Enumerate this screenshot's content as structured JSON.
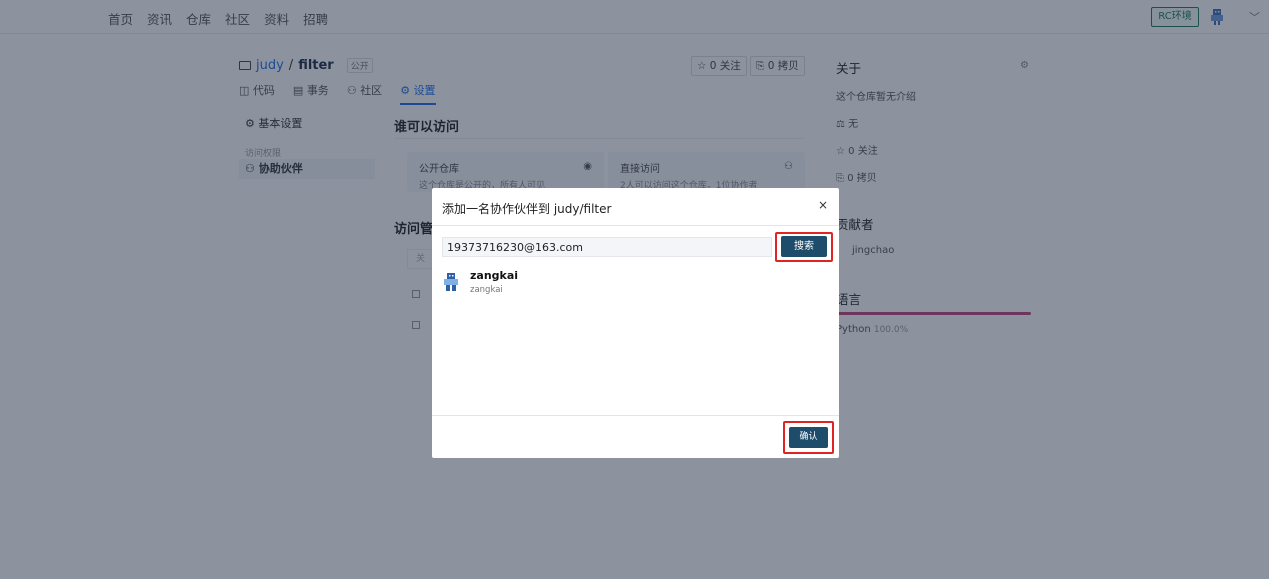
{
  "nav": {
    "items": [
      "首页",
      "资讯",
      "仓库",
      "社区",
      "资料",
      "招聘"
    ],
    "env_button": "RC环境"
  },
  "repo": {
    "owner": "judy",
    "separator": "/",
    "name": "filter",
    "visibility": "公开",
    "watch_label": "0 关注",
    "fork_label": "0 拷贝"
  },
  "tabs": [
    "代码",
    "事务",
    "社区",
    "设置"
  ],
  "settings_sidebar": {
    "basic": "基本设置",
    "group_label": "访问权限",
    "collaborators": "协助伙伴"
  },
  "access": {
    "title": "谁可以访问",
    "public_title": "公开仓库",
    "public_desc": "这个仓库是公开的，所有人可见",
    "direct_title": "直接访问",
    "direct_desc": "2人可以访问这个仓库，1位协作者",
    "manage_title": "访问管理",
    "filter_placeholder": "关"
  },
  "about": {
    "title": "关于",
    "desc": "这个仓库暂无介绍",
    "license": "无",
    "watch": "0 关注",
    "fork": "0 拷贝",
    "contributors_title": "贡献者",
    "contributor": "jingchao",
    "languages_title": "语言",
    "language": "Python",
    "language_pct": "100.0%"
  },
  "modal": {
    "title": "添加一名协作伙伴到 judy/filter",
    "close_icon": "×",
    "search_value": "19373716230@163.com",
    "search_button": "搜索",
    "result": {
      "name": "zangkai",
      "username": "zangkai"
    },
    "confirm_button": "确认"
  },
  "colors": {
    "primary_button": "#1e4c6b",
    "highlight": "#e02424",
    "link": "#1f6feb",
    "overlay": "rgba(25,40,64,0.5)"
  }
}
